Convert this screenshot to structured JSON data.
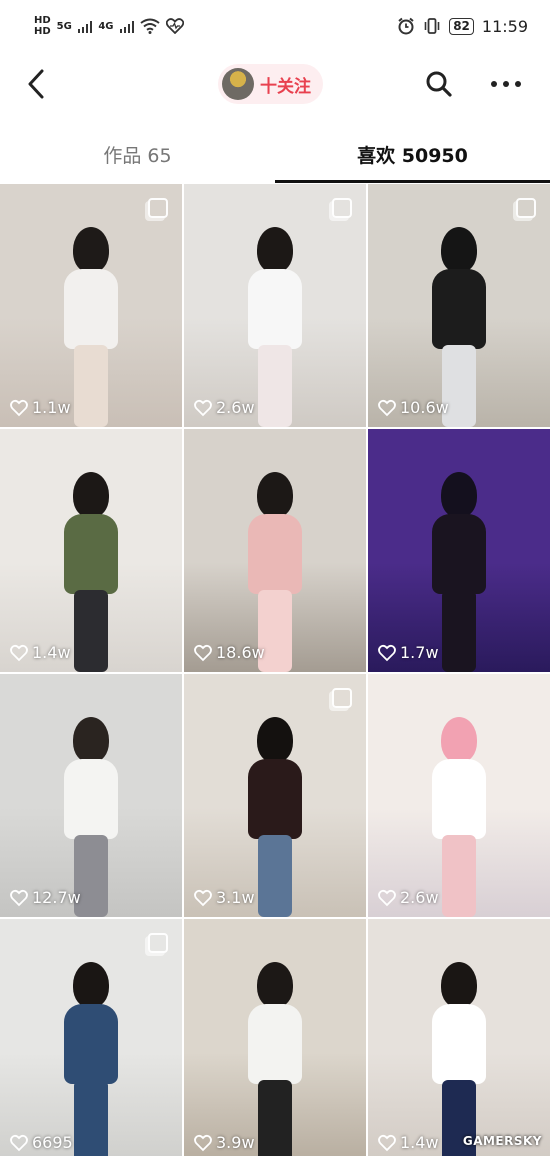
{
  "status_bar": {
    "sim1": "HD",
    "sim2": "HD",
    "net1": "5G",
    "net2": "4G",
    "battery": "82",
    "time": "11:59"
  },
  "nav": {
    "follow_label": "十关注"
  },
  "tabs": [
    {
      "label": "作品 65",
      "active": false
    },
    {
      "label": "喜欢 50950",
      "active": true
    }
  ],
  "grid": [
    {
      "likes": "1.1w",
      "multi": true,
      "bg": "#d9d3cc",
      "shade": "#c9bfb6",
      "hair": "#1e1a18",
      "top": "#f2f0ee",
      "bottom": "#e8dcd2"
    },
    {
      "likes": "2.6w",
      "multi": true,
      "bg": "#e4e2df",
      "shade": "#cfcac4",
      "hair": "#1c1816",
      "top": "#f7f7f7",
      "bottom": "#efe6e6"
    },
    {
      "likes": "10.6w",
      "multi": true,
      "bg": "#d6d2cb",
      "shade": "#b9b3a9",
      "hair": "#151515",
      "top": "#1c1c1c",
      "bottom": "#dfe0e2"
    },
    {
      "likes": "1.4w",
      "multi": false,
      "bg": "#ebe8e4",
      "shade": "#d8d4cf",
      "hair": "#1c1816",
      "top": "#5a6b44",
      "bottom": "#2c2c30"
    },
    {
      "likes": "18.6w",
      "multi": false,
      "bg": "#d7d2cb",
      "shade": "#a49c92",
      "hair": "#1c1816",
      "top": "#eab8b6",
      "bottom": "#f3d1cf"
    },
    {
      "likes": "1.7w",
      "multi": false,
      "bg": "#4b2c8a",
      "shade": "#2a1a5c",
      "hair": "#14101e",
      "top": "#1a1420",
      "bottom": "#1a1420"
    },
    {
      "likes": "12.7w",
      "multi": false,
      "bg": "#d9d9d7",
      "shade": "#c4c4c2",
      "hair": "#2a2420",
      "top": "#f4f4f2",
      "bottom": "#8d8d93"
    },
    {
      "likes": "3.1w",
      "multi": true,
      "bg": "#e2ddd6",
      "shade": "#c9c1b6",
      "hair": "#14110f",
      "top": "#2a1a1a",
      "bottom": "#5b7596"
    },
    {
      "likes": "2.6w",
      "multi": false,
      "bg": "#f2ece8",
      "shade": "#d8cfd4",
      "hair": "#f2a2b2",
      "top": "#ffffff",
      "bottom": "#f0c2c6"
    },
    {
      "likes": "6695",
      "multi": true,
      "bg": "#e6e6e4",
      "shade": "#cfcfcc",
      "hair": "#1a1614",
      "top": "#2f4d74",
      "bottom": "#2f4d74"
    },
    {
      "likes": "3.9w",
      "multi": false,
      "bg": "#dcd6cc",
      "shade": "#b7ad9f",
      "hair": "#1c1816",
      "top": "#f3f3f1",
      "bottom": "#222222"
    },
    {
      "likes": "1.4w",
      "multi": false,
      "bg": "#e6e1dc",
      "shade": "#d1cac3",
      "hair": "#1a1614",
      "top": "#ffffff",
      "bottom": "#1e2a52"
    }
  ],
  "watermark": "GAMERSKY"
}
